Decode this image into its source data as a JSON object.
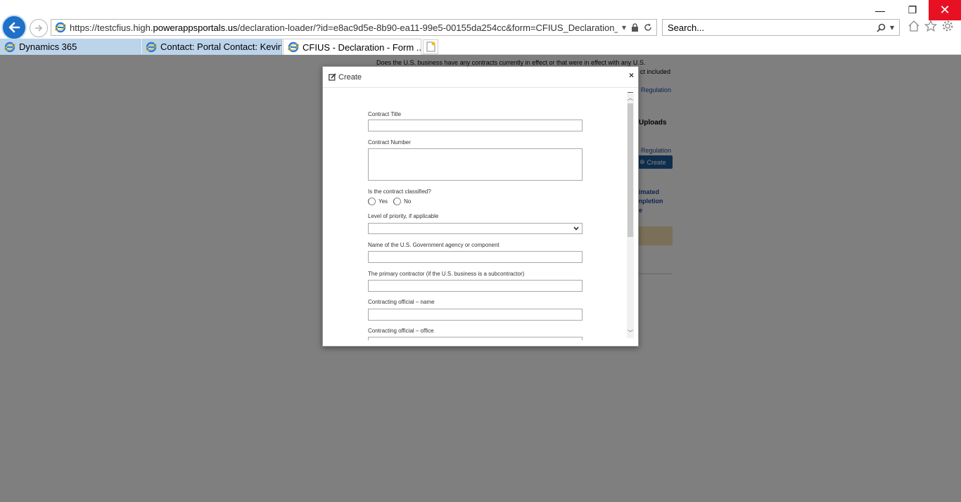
{
  "window": {
    "minimize_glyph": "—",
    "restore_glyph": "❐",
    "close_glyph": "✕"
  },
  "address": {
    "url_prefix": "https://testcfius.high.",
    "url_domain": "powerappsportals.us",
    "url_path": "/declaration-loader/?id=e8ac9d5e-8b90-ea11-99e5-00155da254cc&form=CFIUS_Declaration_US_Business"
  },
  "search": {
    "placeholder": "Search..."
  },
  "tabs": [
    {
      "label": "Dynamics 365"
    },
    {
      "label": "Contact: Portal Contact: Kevin ..."
    },
    {
      "label": "CFIUS - Declaration - Form ..."
    }
  ],
  "background": {
    "question_line1": "Does the U.S. business have any contracts currently in effect or that were in effect with any U.S.",
    "question_line2": "ct included",
    "regulation1": "Regulation",
    "uploads": "Uploads",
    "regulation2": "Regulation",
    "create_label": "Create",
    "col_line1": "timated",
    "col_line2": "mpletion",
    "col_line3": "te"
  },
  "modal": {
    "title": "Create",
    "close_glyph": "×",
    "fields": {
      "contract_title": "Contract Title",
      "contract_number": "Contract Number",
      "classified": "Is the contract classified?",
      "yes": "Yes",
      "no": "No",
      "priority": "Level of priority, if applicable",
      "agency": "Name of the U.S. Government agency or component",
      "primary_contractor": "The primary contractor (if the U.S. business is a subcontractor)",
      "official_name": "Contracting official – name",
      "official_office": "Contracting official – office"
    }
  },
  "colors": {
    "accent": "#1e70c8",
    "close_red": "#e81123",
    "create_button": "#1f5c9c",
    "alert_bg": "#f4e1b3"
  }
}
